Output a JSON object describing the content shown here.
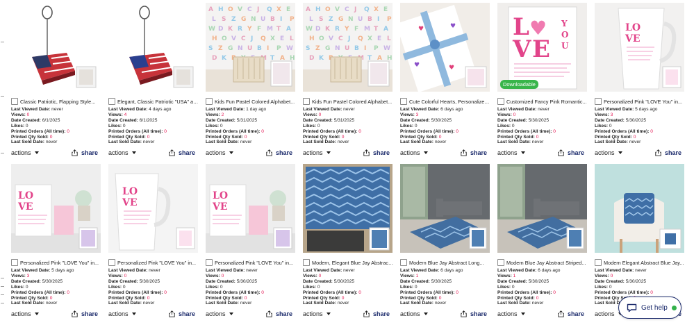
{
  "labels": {
    "last_viewed": "Last Viewed Date:",
    "views": "Views:",
    "date_created": "Date Created:",
    "likes": "Likes:",
    "printed_orders": "Printed Orders (All time):",
    "printed_qty": "Printed Qty Sold:",
    "last_sold": "Last Sold Date:",
    "actions": "actions",
    "share": "share"
  },
  "help": {
    "label": "Get help"
  },
  "products": [
    {
      "title": "Classic Patriotic, Flapping Style...",
      "last_viewed": "never",
      "views": "0",
      "date_created": "6/1/2025",
      "likes": "0",
      "printed_orders": "0",
      "printed_qty": "0",
      "last_sold": "never",
      "image": "flag-photo-holder"
    },
    {
      "title": "Elegant, Classic Patriotic \"USA\" and...",
      "last_viewed": "4 days ago",
      "views": "4",
      "date_created": "6/1/2025",
      "likes": "0",
      "printed_orders": "0",
      "printed_qty": "0",
      "last_sold": "never",
      "image": "usa-photo-holder"
    },
    {
      "title": "Kids Fun Pastel Colored Alphabet...",
      "last_viewed": "1 day ago",
      "views": "2",
      "date_created": "5/31/2025",
      "likes": "0",
      "printed_orders": "0",
      "printed_qty": "0",
      "last_sold": "never",
      "image": "alphabet-wallpaper"
    },
    {
      "title": "Kids Fun Pastel Colored Alphabet...",
      "last_viewed": "never",
      "views": "0",
      "date_created": "5/31/2025",
      "likes": "0",
      "printed_orders": "0",
      "printed_qty": "0",
      "last_sold": "never",
      "image": "alphabet-wallpaper"
    },
    {
      "title": "Cute Colorful Hearts, Personalized...",
      "last_viewed": "6 days ago",
      "views": "3",
      "date_created": "5/30/2025",
      "likes": "0",
      "printed_orders": "0",
      "printed_qty": "0",
      "last_sold": "never",
      "image": "gift-wrap"
    },
    {
      "title": "Customized Fancy Pink Romantic...",
      "last_viewed": "never",
      "views": "0",
      "date_created": "5/30/2025",
      "likes": "0",
      "printed_orders": "0",
      "printed_qty": "0",
      "last_sold": "never",
      "image": "love-print",
      "badge": "Downloadable"
    },
    {
      "title": "Personalized Pink \"LOVE You\" in...",
      "last_viewed": "5 days ago",
      "views": "3",
      "date_created": "5/30/2025",
      "likes": "0",
      "printed_orders": "0",
      "printed_qty": "0",
      "last_sold": "never",
      "image": "love-mug-tall"
    },
    {
      "title": "Personalized Pink \"LOVE You\" in...",
      "last_viewed": "5 days ago",
      "views": "3",
      "date_created": "5/30/2025",
      "likes": "0",
      "printed_orders": "0",
      "printed_qty": "0",
      "last_sold": "never",
      "image": "love-mug-scene"
    },
    {
      "title": "Personalized Pink \"LOVE You\" in...",
      "last_viewed": "never",
      "views": "0",
      "date_created": "5/30/2025",
      "likes": "0",
      "printed_orders": "0",
      "printed_qty": "0",
      "last_sold": "never",
      "image": "love-mug-white"
    },
    {
      "title": "Personalized Pink \"LOVE You\" in...",
      "last_viewed": "never",
      "views": "0",
      "date_created": "5/30/2025",
      "likes": "0",
      "printed_orders": "0",
      "printed_qty": "0",
      "last_sold": "never",
      "image": "love-mug-scene"
    },
    {
      "title": "Modern, Elegant Blue Jay Abstract...",
      "last_viewed": "never",
      "views": "0",
      "date_created": "5/30/2025",
      "likes": "0",
      "printed_orders": "0",
      "printed_qty": "0",
      "last_sold": "never",
      "image": "blue-rug-top"
    },
    {
      "title": "Modern Blue Jay Abstract Long...",
      "last_viewed": "6 days ago",
      "views": "1",
      "date_created": "5/30/2025",
      "likes": "0",
      "printed_orders": "0",
      "printed_qty": "0",
      "last_sold": "never",
      "image": "blue-rug-room"
    },
    {
      "title": "Modern Blue Jay Abstract Striped...",
      "last_viewed": "6 days ago",
      "views": "1",
      "date_created": "5/30/2025",
      "likes": "0",
      "printed_orders": "0",
      "printed_qty": "0",
      "last_sold": "never",
      "image": "blue-rug-room"
    },
    {
      "title": "Modern Elegant Abstract Blue Jay...",
      "last_viewed": "never",
      "views": "0",
      "date_created": "5/30/2025",
      "likes": "0",
      "printed_orders": "0",
      "printed_qty": "0",
      "last_sold": "never",
      "image": "blue-pillow"
    }
  ],
  "colors": {
    "accent_red": "#e3134f",
    "navy": "#1b2a6b",
    "badge_green": "#39b54a",
    "online_green": "#33b14a"
  }
}
